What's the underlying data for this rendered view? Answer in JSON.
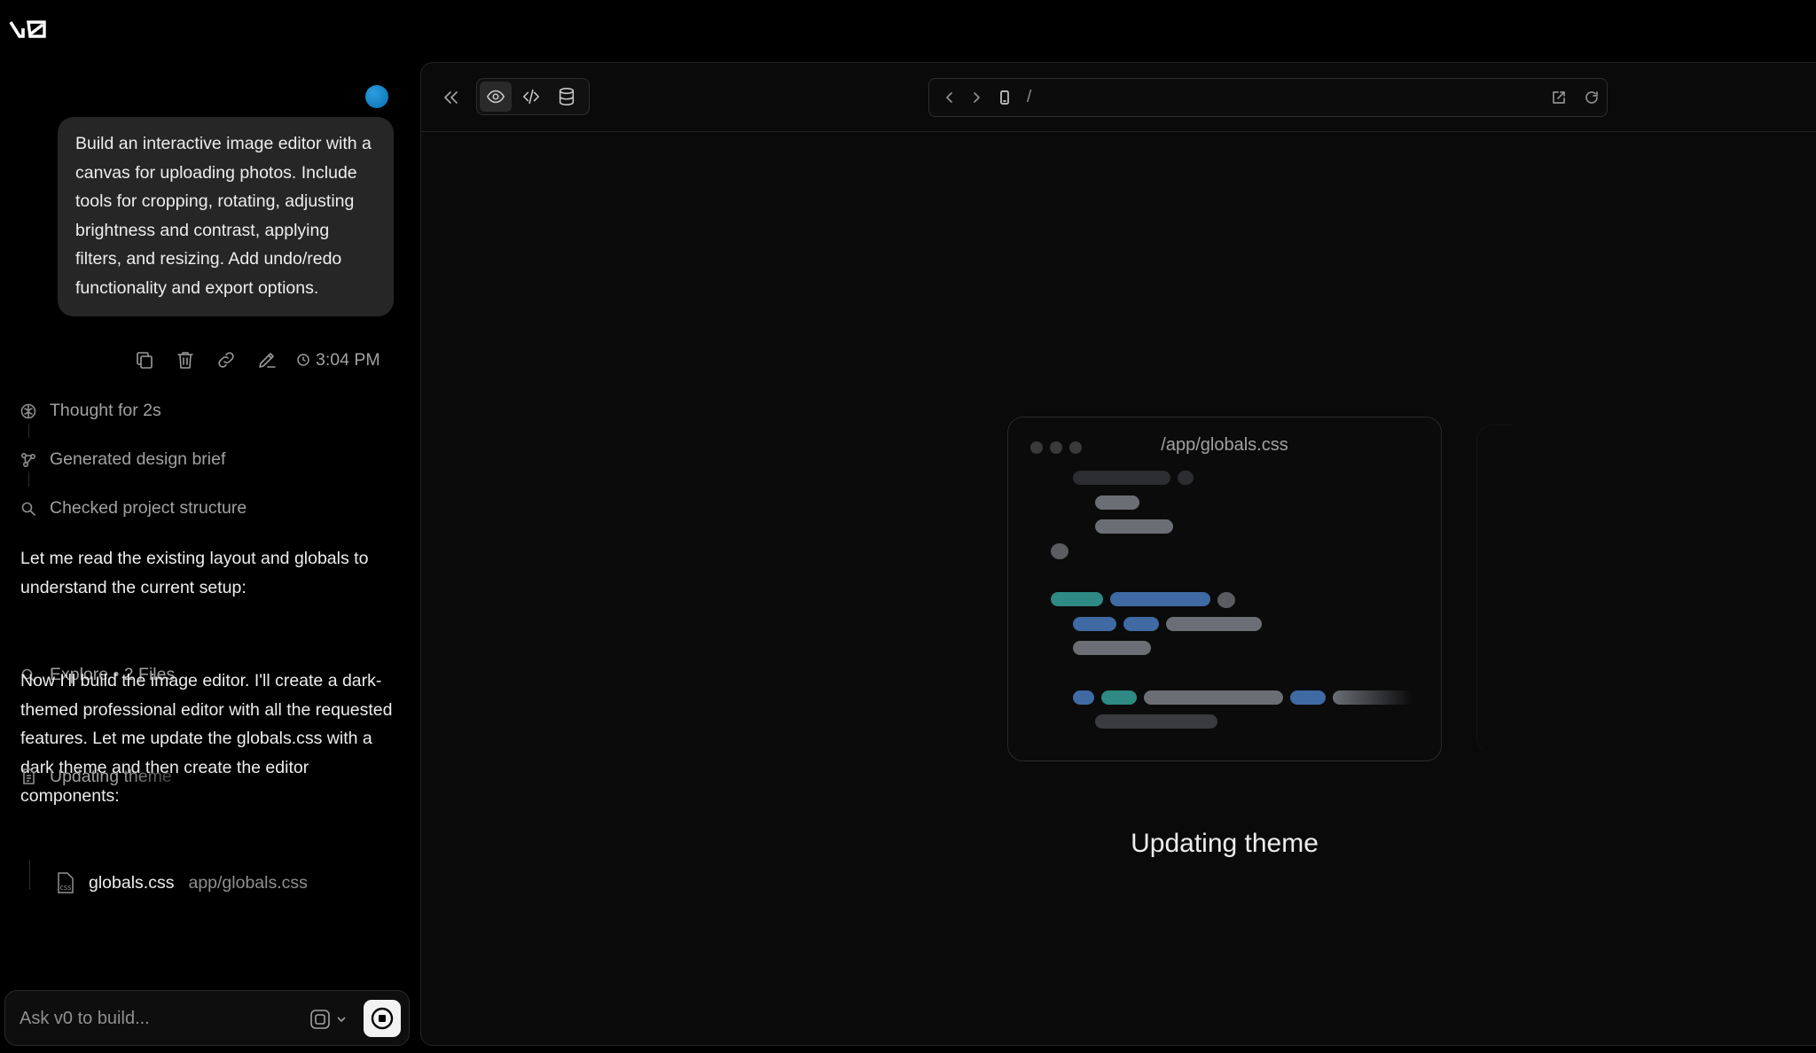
{
  "app": {
    "logo_text": "v0"
  },
  "chat": {
    "user_message": "Build an interactive image editor with a canvas for uploading photos. Include tools for cropping, rotating, adjusting brightness and contrast, applying filters, and resizing. Add undo/redo functionality and export options.",
    "message_time": "3:04 PM",
    "steps": [
      {
        "icon": "brain-icon",
        "label": "Thought for 2s"
      },
      {
        "icon": "workflow-icon",
        "label": "Generated design brief"
      },
      {
        "icon": "search-icon",
        "label": "Checked project structure"
      }
    ],
    "paragraph_1": "Let me read the existing layout and globals to understand the current setup:",
    "explore_label": "Explore • 2 Files",
    "paragraph_2": "Now I'll build the image editor. I'll create a dark-themed professional editor with all the requested features. Let me update the globals.css with a dark theme and then create the editor components:",
    "updating_label": "Updating theme",
    "file": {
      "name": "globals.css",
      "path": "app/globals.css",
      "icon": "css-file-icon"
    }
  },
  "composer": {
    "placeholder": "Ask v0 to build...",
    "model_icon": "model-chip-icon",
    "stop_icon": "stop-icon"
  },
  "preview": {
    "url_path": "/",
    "card_title": "/app/globals.css",
    "status": "Updating theme",
    "active_view": "preview"
  },
  "colors": {
    "background": "#000000",
    "panel": "#0a0a0a",
    "bubble": "#262626",
    "avatar": "#1a8ad4",
    "code_teal": "#2e8a82",
    "code_blue": "#3f6aa3",
    "code_gray": "#6b6e75"
  }
}
